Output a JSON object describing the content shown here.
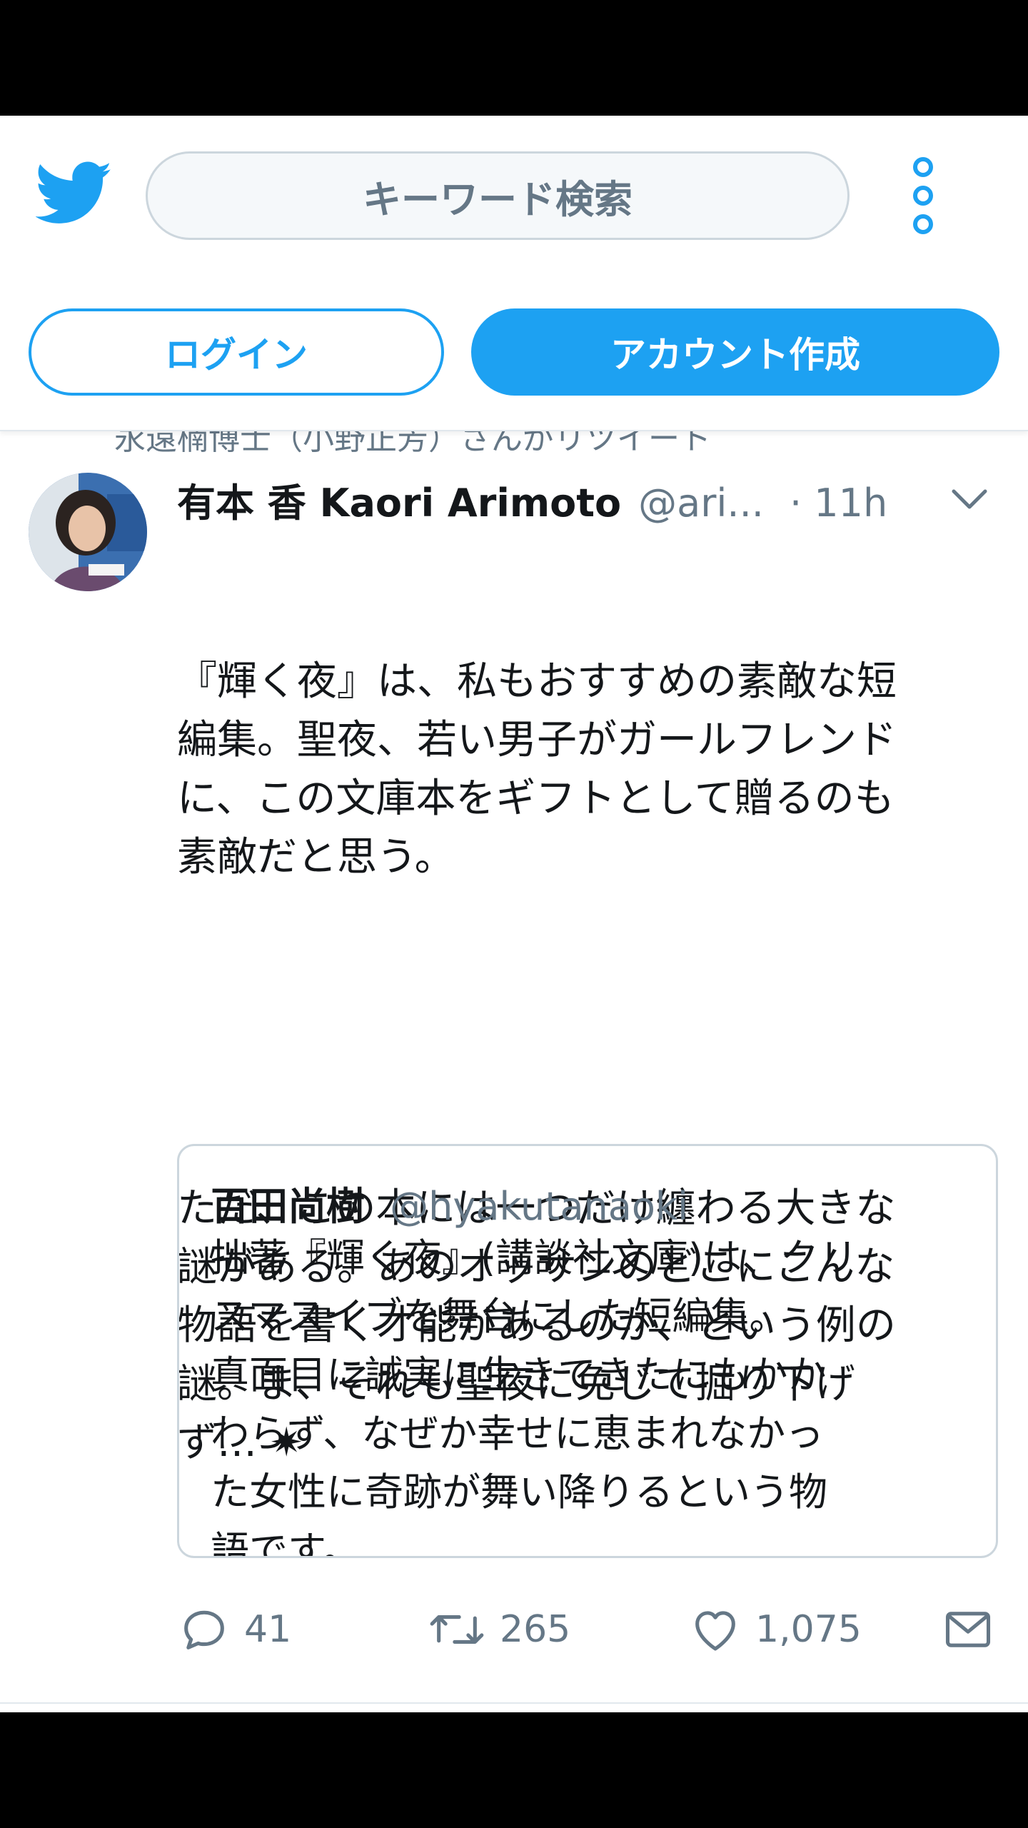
{
  "header": {
    "search_placeholder": "キーワード検索",
    "login_label": "ログイン",
    "signup_label": "アカウント作成",
    "logo_icon": "twitter-bird-icon",
    "menu_icon": "more-vertical-icon"
  },
  "retweet_context": "永遠楠博士（小野正芳）さんがリツイート",
  "tweet": {
    "name": "有本 香 Kaori Arimoto",
    "handle": "@ari...",
    "time": "· 11h",
    "text_p1": "『輝く夜』は、私もおすすめの素敵な短\n編集。聖夜、若い男子がガールフレンド\nに、この文庫本をギフトとして贈るのも\n素敵だと思う。",
    "text_p2": "ただ、この本には一つだけ纏わる大きな\n謎がある。あのオッサンのどこにこんな\n物語を書く才能があるのか、という例の\n謎。ま、それも聖夜に免じて掘り下げ\nず… ✷",
    "quote": {
      "name": "百田尚樹",
      "handle": "@hyakutanaoki",
      "text": "拙著『輝く夜』(講談社文庫)は、クリ\nスマスイブを舞台にした短編集。\n真面目に誠実に生きてきたにもかか\nわらず、なぜか幸せに恵まれなかっ\nた女性に奇跡が舞い降りるという物\n語です。"
    },
    "actions": {
      "replies": "41",
      "retweets": "265",
      "likes": "1,075"
    }
  },
  "colors": {
    "accent": "#1da1f2",
    "secondary_text": "#657786",
    "border": "#ccd6dd"
  }
}
